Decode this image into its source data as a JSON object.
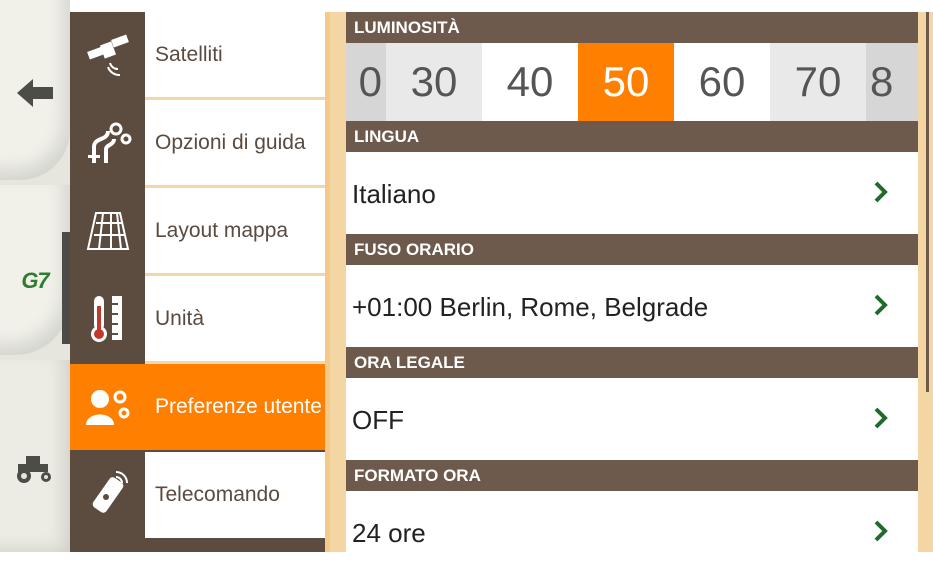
{
  "rail": {
    "icons": [
      "back-arrow-icon",
      "g7-logo-icon",
      "tractor-icon"
    ],
    "logo_text": "G7"
  },
  "menu": {
    "items": [
      {
        "label": "Satelliti",
        "icon": "satellite-icon",
        "active": false
      },
      {
        "label": "Opzioni di guida",
        "icon": "guidance-options-icon",
        "active": false
      },
      {
        "label": "Layout mappa",
        "icon": "map-layout-icon",
        "active": false
      },
      {
        "label": "Unità",
        "icon": "units-thermometer-icon",
        "active": false
      },
      {
        "label": "Preferenze utente",
        "icon": "user-preferences-icon",
        "active": true
      },
      {
        "label": "Telecomando",
        "icon": "remote-control-icon",
        "active": false
      }
    ]
  },
  "settings": {
    "brightness": {
      "header": "LUMINOSITÀ",
      "values": [
        "0",
        "30",
        "40",
        "50",
        "60",
        "70",
        "8"
      ],
      "selected": "50"
    },
    "language": {
      "header": "LINGUA",
      "value": "Italiano"
    },
    "timezone": {
      "header": "FUSO ORARIO",
      "value": "+01:00 Berlin, Rome, Belgrade"
    },
    "dst": {
      "header": "ORA LEGALE",
      "value": "OFF"
    },
    "time_format": {
      "header": "FORMATO ORA",
      "value": "24 ore"
    }
  },
  "colors": {
    "accent": "#ff7f00",
    "header_brown": "#6e5a4c",
    "menu_brown": "#5c4b3f",
    "chevron_green": "#1f6b2b"
  }
}
